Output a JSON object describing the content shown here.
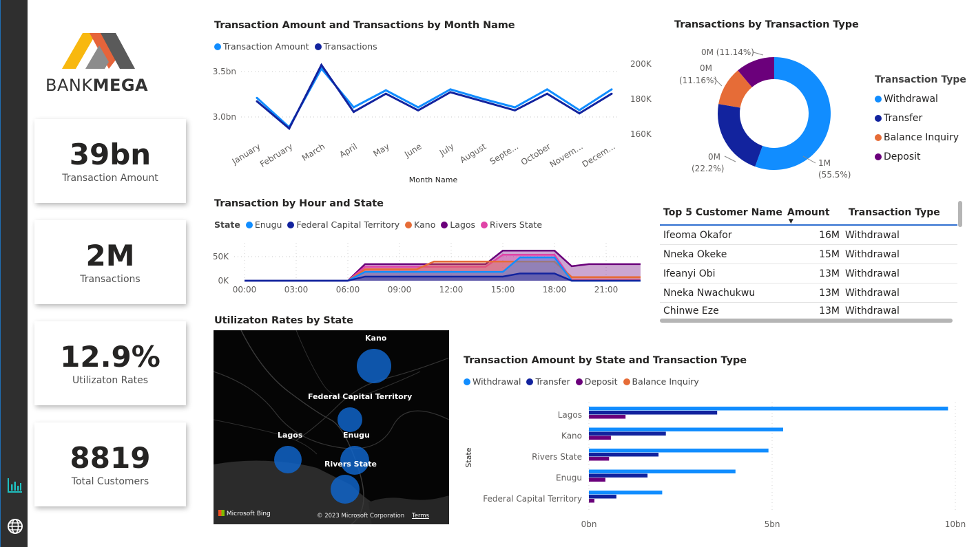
{
  "brand": {
    "name_part1": "BANK",
    "name_part2": "MEGA"
  },
  "nav": {
    "icons": [
      "bar-chart-icon",
      "globe-icon"
    ]
  },
  "kpis": [
    {
      "value": "39bn",
      "label": "Transaction Amount"
    },
    {
      "value": "2M",
      "label": "Transactions"
    },
    {
      "value": "12.9%",
      "label": "Utilizaton Rates"
    },
    {
      "value": "8819",
      "label": "Total Customers"
    }
  ],
  "colors": {
    "blue": "#118DFF",
    "navy": "#12239E",
    "orange": "#E66C37",
    "purple": "#6B007B",
    "pink": "#E044A7"
  },
  "charts": {
    "monthly": {
      "title": "Transaction Amount and Transactions by Month Name",
      "legend": [
        "Transaction Amount",
        "Transactions"
      ],
      "xlabel": "Month Name",
      "y_left_ticks": [
        "3.5bn",
        "3.0bn"
      ],
      "y_right_ticks": [
        "200K",
        "180K",
        "160K"
      ],
      "months": [
        "January",
        "February",
        "March",
        "April",
        "May",
        "June",
        "July",
        "August",
        "Septe...",
        "October",
        "Novem...",
        "Decem..."
      ]
    },
    "hourly": {
      "title": "Transaction by Hour and State",
      "legend_label": "State",
      "legend": [
        "Enugu",
        "Federal Capital Territory",
        "Kano",
        "Lagos",
        "Rivers State"
      ],
      "y_ticks": [
        "50K",
        "0K"
      ],
      "x_ticks": [
        "00:00",
        "03:00",
        "06:00",
        "09:00",
        "12:00",
        "15:00",
        "18:00",
        "21:00"
      ]
    },
    "type_donut": {
      "title": "Transactions by Transaction Type",
      "legend_title": "Transaction Type",
      "legend": [
        "Withdrawal",
        "Transfer",
        "Balance Inquiry",
        "Deposit"
      ],
      "labels": {
        "withdrawal": [
          "1M",
          "(55.5%)"
        ],
        "transfer": [
          "0M",
          "(22.2%)"
        ],
        "balance": [
          "0M",
          "(11.16%)"
        ],
        "deposit": [
          "0M (11.14%)"
        ]
      }
    },
    "state_bars": {
      "title": "Transaction Amount by State and Transaction Type",
      "legend": [
        "Withdrawal",
        "Transfer",
        "Deposit",
        "Balance Inquiry"
      ],
      "ylabel": "State",
      "x_ticks": [
        "0bn",
        "5bn",
        "10bn"
      ]
    }
  },
  "table": {
    "headers": [
      "Top 5 Customer Name",
      "Amount",
      "Transaction Type"
    ],
    "rows": [
      [
        "Ifeoma Okafor",
        "16M",
        "Withdrawal"
      ],
      [
        "Nneka Okeke",
        "15M",
        "Withdrawal"
      ],
      [
        "Ifeanyi Obi",
        "13M",
        "Withdrawal"
      ],
      [
        "Nneka Nwachukwu",
        "13M",
        "Withdrawal"
      ],
      [
        "Chinwe Eze",
        "13M",
        "Withdrawal"
      ]
    ]
  },
  "map": {
    "title": "Utilizaton Rates by State",
    "labels": [
      "Kano",
      "Federal Capital Territory",
      "Lagos",
      "Enugu",
      "Rivers State"
    ],
    "bing": "Microsoft Bing",
    "copyright": "© 2023 Microsoft Corporation",
    "terms": "Terms"
  },
  "chart_data": [
    {
      "type": "line",
      "title": "Transaction Amount and Transactions by Month Name",
      "xlabel": "Month Name",
      "categories": [
        "January",
        "February",
        "March",
        "April",
        "May",
        "June",
        "July",
        "August",
        "September",
        "October",
        "November",
        "December"
      ],
      "series": [
        {
          "name": "Transaction Amount",
          "axis": "left",
          "values": [
            3.22,
            2.91,
            3.53,
            3.12,
            3.3,
            3.12,
            3.31,
            3.21,
            3.12,
            3.31,
            3.09,
            3.31
          ]
        },
        {
          "name": "Transactions",
          "axis": "right",
          "values": [
            179000,
            161000,
            203000,
            172000,
            184000,
            173000,
            185000,
            179000,
            173000,
            184000,
            171000,
            184000
          ]
        }
      ],
      "ylim_left": [
        2.8,
        3.6
      ],
      "ylim_right": [
        155000,
        205000
      ]
    },
    {
      "type": "area",
      "title": "Transaction by Hour and State",
      "x": [
        0,
        1,
        2,
        3,
        4,
        5,
        6,
        7,
        8,
        9,
        10,
        11,
        12,
        13,
        14,
        15,
        16,
        17,
        18,
        19,
        20,
        21,
        22,
        23
      ],
      "series": [
        {
          "name": "Enugu",
          "values": [
            0,
            0,
            0,
            0,
            0,
            0,
            0,
            17000,
            17000,
            17000,
            17000,
            17000,
            17000,
            17000,
            17000,
            17000,
            45000,
            45000,
            45000,
            0,
            0,
            0,
            0,
            0
          ]
        },
        {
          "name": "Federal Capital Territory",
          "values": [
            0,
            0,
            0,
            0,
            0,
            0,
            0,
            8000,
            8000,
            8000,
            8000,
            8000,
            8000,
            8000,
            8000,
            8000,
            14000,
            14000,
            14000,
            0,
            0,
            0,
            0,
            0
          ]
        },
        {
          "name": "Kano",
          "values": [
            0,
            0,
            0,
            0,
            0,
            0,
            0,
            22000,
            22000,
            22000,
            22000,
            37000,
            37000,
            37000,
            37000,
            37000,
            37000,
            37000,
            37000,
            7000,
            7000,
            7000,
            7000,
            7000
          ]
        },
        {
          "name": "Lagos",
          "values": [
            0,
            0,
            0,
            0,
            0,
            0,
            0,
            32000,
            32000,
            32000,
            32000,
            32000,
            32000,
            32000,
            32000,
            58000,
            58000,
            58000,
            58000,
            28000,
            32000,
            32000,
            32000,
            32000
          ]
        },
        {
          "name": "Rivers State",
          "values": [
            0,
            0,
            0,
            0,
            0,
            0,
            0,
            27000,
            27000,
            27000,
            27000,
            27000,
            27000,
            27000,
            27000,
            50000,
            50000,
            50000,
            50000,
            2000,
            2000,
            2000,
            2000,
            2000
          ]
        }
      ],
      "ylim": [
        0,
        65000
      ]
    },
    {
      "type": "pie",
      "title": "Transactions by Transaction Type",
      "categories": [
        "Withdrawal",
        "Transfer",
        "Balance Inquiry",
        "Deposit"
      ],
      "values": [
        55.5,
        22.2,
        11.16,
        11.14
      ]
    },
    {
      "type": "bar",
      "orientation": "horizontal",
      "title": "Transaction Amount by State and Transaction Type",
      "ylabel": "State",
      "categories": [
        "Lagos",
        "Kano",
        "Rivers State",
        "Enugu",
        "Federal Capital Territory"
      ],
      "series": [
        {
          "name": "Withdrawal",
          "values": [
            9.8,
            5.3,
            4.9,
            4.0,
            2.0
          ]
        },
        {
          "name": "Transfer",
          "values": [
            3.5,
            2.1,
            1.9,
            1.6,
            0.75
          ]
        },
        {
          "name": "Deposit",
          "values": [
            1.0,
            0.6,
            0.55,
            0.45,
            0.15
          ]
        },
        {
          "name": "Balance Inquiry",
          "values": [
            0,
            0,
            0,
            0,
            0
          ]
        }
      ],
      "xlim": [
        0,
        10
      ]
    }
  ]
}
